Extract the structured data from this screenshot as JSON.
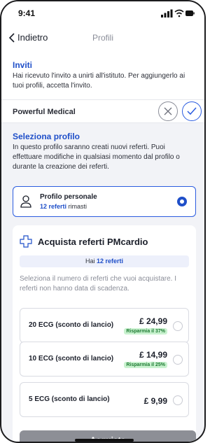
{
  "status_bar": {
    "time": "9:41"
  },
  "nav": {
    "back_label": "Indietro",
    "title": "Profili"
  },
  "invites": {
    "heading": "Inviti",
    "description": "Hai ricevuto l'invito a unirti all'istituto. Per aggiungerlo ai tuoi profili, accetta l'invito.",
    "organization": "Powerful Medical"
  },
  "select_profile": {
    "heading": "Seleziona profilo",
    "description": "In questo profilo saranno creati nuovi referti. Puoi effettuare modifiche in qualsiasi momento dal profilo o durante la creazione dei referti.",
    "profile": {
      "name": "Profilo personale",
      "reports_count": "12 referti",
      "reports_suffix": "rimasti",
      "selected": true
    }
  },
  "purchase": {
    "heading": "Acquista referti PMcardio",
    "have_prefix": "Hai",
    "have_count": "12 referti",
    "info": "Seleziona il numero di referti che vuoi acquistare. I referti non hanno data di scadenza.",
    "options": [
      {
        "label": "20 ECG (sconto di lancio)",
        "price": "£ 24,99",
        "saving": "Risparmia il 37%"
      },
      {
        "label": "10 ECG (sconto di lancio)",
        "price": "£ 14,99",
        "saving": "Risparmia il 25%"
      },
      {
        "label": "5 ECG (sconto di lancio)",
        "price": "£ 9,99",
        "saving": ""
      }
    ],
    "buy_label": "Acquista"
  },
  "colors": {
    "accent": "#1f4fc9",
    "accent_border": "#2b5ce0",
    "saving_bg": "#c9f2cf",
    "saving_text": "#1d7a32",
    "buy_button": "#8d8f96"
  },
  "icons": [
    "signal-icon",
    "wifi-icon",
    "battery-icon",
    "chevron-left-icon",
    "close-icon",
    "check-icon",
    "user-icon",
    "add-icon"
  ]
}
